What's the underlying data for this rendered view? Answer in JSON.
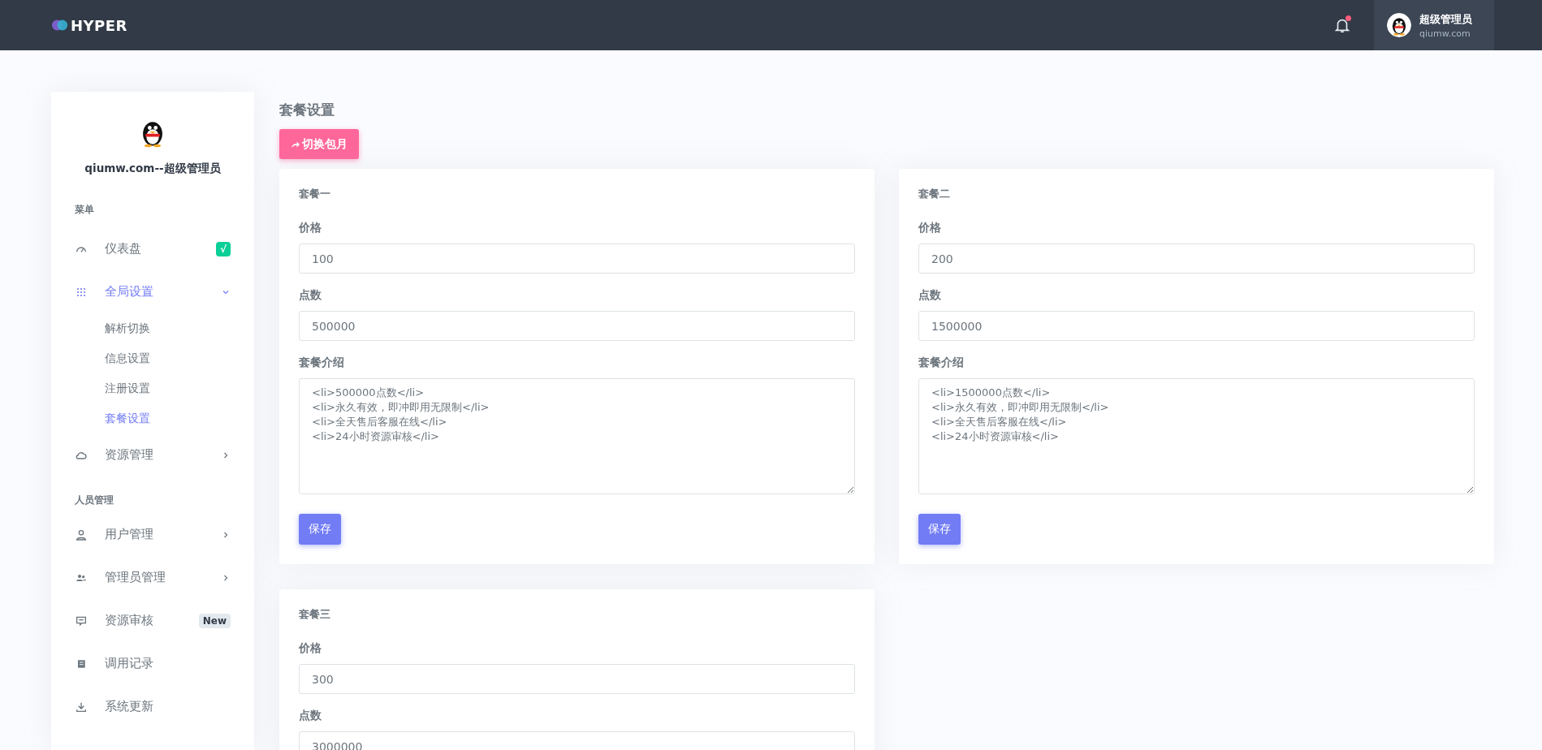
{
  "topbar": {
    "logo": "HYPER",
    "user": {
      "name": "超级管理员",
      "site": "qiumw.com"
    },
    "notification": true
  },
  "sidebar": {
    "profile": "qiumw.com--超级管理员",
    "sections": [
      {
        "title": "菜单",
        "items": [
          {
            "label": "仪表盘",
            "selected": false,
            "badge": {
              "text": "√",
              "color": "#0acf97"
            }
          },
          {
            "label": "全局设置",
            "selected": true,
            "expanded": true,
            "children": [
              {
                "label": "解析切换",
                "selected": false
              },
              {
                "label": "信息设置",
                "selected": false
              },
              {
                "label": "注册设置",
                "selected": false
              },
              {
                "label": "套餐设置",
                "selected": true
              }
            ]
          },
          {
            "label": "资源管理",
            "selected": false,
            "expanded": false
          }
        ]
      },
      {
        "title": "人员管理",
        "items": [
          {
            "label": "用户管理",
            "selected": false,
            "expanded": false
          },
          {
            "label": "管理员管理",
            "selected": false,
            "expanded": false
          },
          {
            "label": "资源审核",
            "selected": false,
            "badge": {
              "text": "New",
              "color": "#e3eaef"
            }
          },
          {
            "label": "调用记录",
            "selected": false
          },
          {
            "label": "系统更新",
            "selected": false
          }
        ]
      }
    ]
  },
  "page": {
    "title": "套餐设置",
    "switch_button": "切换包月",
    "plans": [
      {
        "title": "套餐一",
        "price_label": "价格",
        "price": "100",
        "points_label": "点数",
        "points": "500000",
        "intro_label": "套餐介绍",
        "intro": "<li>500000点数</li>\n<li>永久有效，即冲即用无限制</li>\n<li>全天售后客服在线</li>\n<li>24小时资源审核</li>",
        "save": "保存"
      },
      {
        "title": "套餐二",
        "price_label": "价格",
        "price": "200",
        "points_label": "点数",
        "points": "1500000",
        "intro_label": "套餐介绍",
        "intro": "<li>1500000点数</li>\n<li>永久有效，即冲即用无限制</li>\n<li>全天售后客服在线</li>\n<li>24小时资源审核</li>",
        "save": "保存"
      },
      {
        "title": "套餐三",
        "price_label": "价格",
        "price": "300",
        "points_label": "点数",
        "points": "3000000"
      }
    ]
  }
}
